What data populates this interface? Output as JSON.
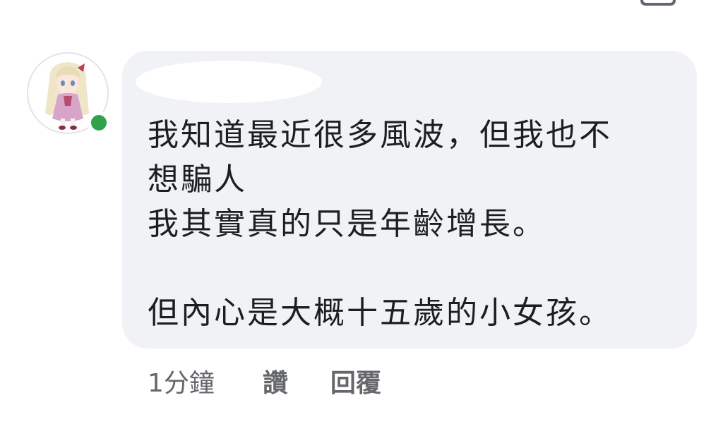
{
  "comment": {
    "text": "我知道最近很多風波，但我也不\n想騙人\n我其實真的只是年齡增長。\n\n但內心是大概十五歲的小女孩。",
    "online": true
  },
  "actions": {
    "timestamp": "1分鐘",
    "like_label": "讚",
    "reply_label": "回覆"
  },
  "colors": {
    "bubble": "#f0f2f5",
    "online": "#31a24c",
    "text": "#1c1e21",
    "meta": "#65676b"
  }
}
